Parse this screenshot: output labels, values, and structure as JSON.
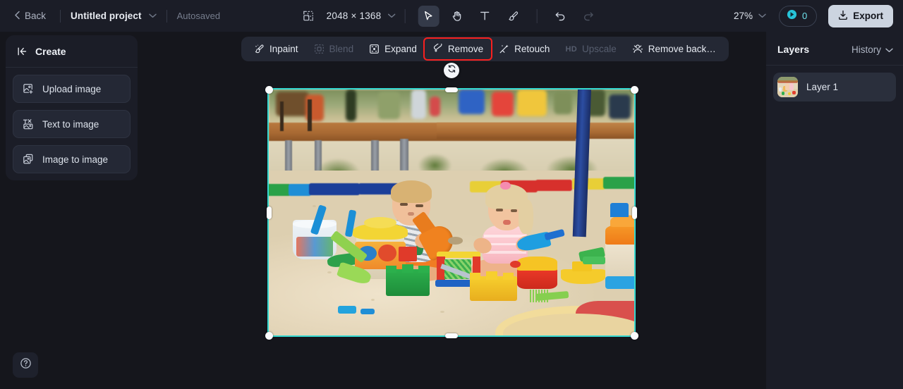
{
  "topbar": {
    "back_label": "Back",
    "project_name": "Untitled project",
    "autosaved_label": "Autosaved",
    "canvas_dimensions": "2048 × 1368",
    "zoom_level": "27%",
    "credits_count": "0",
    "export_label": "Export",
    "tools": [
      {
        "name": "select-tool",
        "glyph": "cursor",
        "state": "active"
      },
      {
        "name": "hand-tool",
        "glyph": "hand",
        "state": "enabled"
      },
      {
        "name": "text-tool",
        "glyph": "text",
        "state": "enabled"
      },
      {
        "name": "brush-tool",
        "glyph": "brush",
        "state": "enabled"
      },
      {
        "name": "undo-button",
        "glyph": "undo",
        "state": "enabled"
      },
      {
        "name": "redo-button",
        "glyph": "redo",
        "state": "disabled"
      }
    ]
  },
  "sidebar": {
    "title": "Create",
    "items": [
      {
        "label": "Upload image",
        "icon": "upload-image-icon"
      },
      {
        "label": "Text to image",
        "icon": "text-to-image-icon"
      },
      {
        "label": "Image to image",
        "icon": "image-to-image-icon"
      }
    ]
  },
  "edit_toolbar": {
    "items": [
      {
        "label": "Inpaint",
        "icon": "inpaint-icon",
        "disabled": false,
        "highlighted": false
      },
      {
        "label": "Blend",
        "icon": "blend-icon",
        "disabled": true,
        "highlighted": false
      },
      {
        "label": "Expand",
        "icon": "expand-icon",
        "disabled": false,
        "highlighted": false
      },
      {
        "label": "Remove",
        "icon": "remove-eraser-icon",
        "disabled": false,
        "highlighted": true
      },
      {
        "label": "Retouch",
        "icon": "retouch-icon",
        "disabled": false,
        "highlighted": false
      },
      {
        "label": "Upscale",
        "icon": "hd-icon",
        "disabled": true,
        "highlighted": false,
        "prefix": "HD"
      },
      {
        "label": "Remove back…",
        "icon": "remove-background-icon",
        "disabled": false,
        "highlighted": false
      }
    ]
  },
  "right_panel": {
    "title": "Layers",
    "history_label": "History",
    "layers": [
      {
        "name": "Layer 1"
      }
    ]
  },
  "canvas": {
    "selection_color": "#34d8d0",
    "rotate_icon": "refresh-rotate-icon",
    "image_alt": "Two toddlers playing with colorful plastic toys in a playground sandbox"
  },
  "help": {
    "icon": "help-circle-icon"
  },
  "colors": {
    "app_background": "#15161c",
    "panel_background": "#1b1d27",
    "accent_cyan": "#34d8d0",
    "highlight_red": "#f8201f",
    "export_button": "#ccd4e0"
  }
}
